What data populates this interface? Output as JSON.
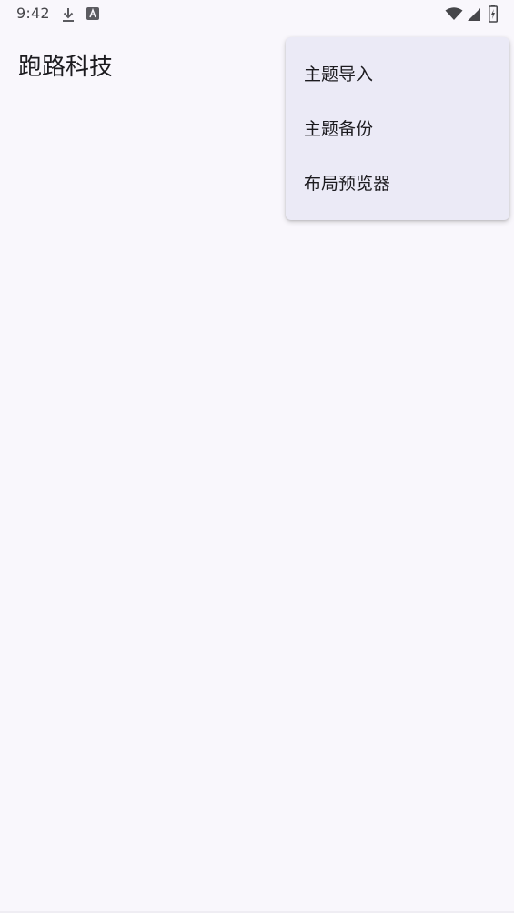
{
  "status_bar": {
    "time": "9:42",
    "icons": [
      "download-icon",
      "a-badge-icon",
      "wifi-icon",
      "cell-signal-icon",
      "battery-charging-icon"
    ]
  },
  "app_bar": {
    "title": "跑路科技"
  },
  "overflow_menu": {
    "items": [
      {
        "label": "主题导入"
      },
      {
        "label": "主题备份"
      },
      {
        "label": "布局预览器"
      }
    ]
  },
  "colors": {
    "background": "#f9f7fc",
    "menu_background": "#ebeaf6",
    "text_primary": "#1c1b1f",
    "status_icon": "#46464a"
  }
}
